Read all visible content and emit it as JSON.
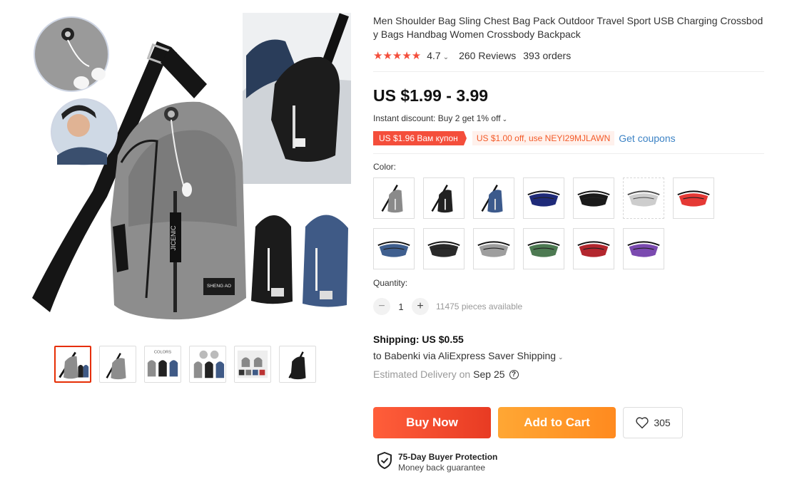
{
  "product": {
    "title": "Men Shoulder Bag Sling Chest Bag Pack Outdoor Travel Sport USB Charging Crossbody Bags Handbag Women Crossbody Backpack",
    "rating": "4.7",
    "reviews": "260 Reviews",
    "orders": "393 orders",
    "price": "US $1.99 - 3.99",
    "instant_discount": "Instant discount: Buy 2 get 1% off",
    "coupon_red": "US $1.96 Вам купон",
    "coupon_code": "US $1.00 off, use NEYI29MJLAWN",
    "get_coupons": "Get coupons"
  },
  "options": {
    "color_label": "Color:",
    "swatches": [
      {
        "color": "#8a8a8a",
        "shape": "sling"
      },
      {
        "color": "#222222",
        "shape": "sling"
      },
      {
        "color": "#3c5a8c",
        "shape": "sling"
      },
      {
        "color": "#1f2b7a",
        "shape": "waist"
      },
      {
        "color": "#1a1a1a",
        "shape": "waist"
      },
      {
        "color": "#bdbdbd",
        "shape": "waist"
      },
      {
        "color": "#e53935",
        "shape": "waist"
      },
      {
        "color": "#3f5f8f",
        "shape": "waist"
      },
      {
        "color": "#2a2a2a",
        "shape": "waist"
      },
      {
        "color": "#9e9e9e",
        "shape": "waist"
      },
      {
        "color": "#4d7a52",
        "shape": "waist"
      },
      {
        "color": "#b3262e",
        "shape": "waist"
      },
      {
        "color": "#7b4ab0",
        "shape": "waist"
      }
    ],
    "quantity_label": "Quantity:",
    "quantity": "1",
    "pieces_available": "11475 pieces available"
  },
  "shipping": {
    "title": "Shipping: US $0.55",
    "to": "to Babenki via AliExpress Saver Shipping",
    "estimated": "Estimated Delivery on",
    "date": "Sep 25"
  },
  "actions": {
    "buy_now": "Buy Now",
    "add_to_cart": "Add to Cart",
    "wishlist_count": "305"
  },
  "protection": {
    "title": "75-Day Buyer Protection",
    "subtitle": "Money back guarantee"
  },
  "gallery": {
    "main_bag_color": "#8d8d8d",
    "thumb_count": 6
  }
}
